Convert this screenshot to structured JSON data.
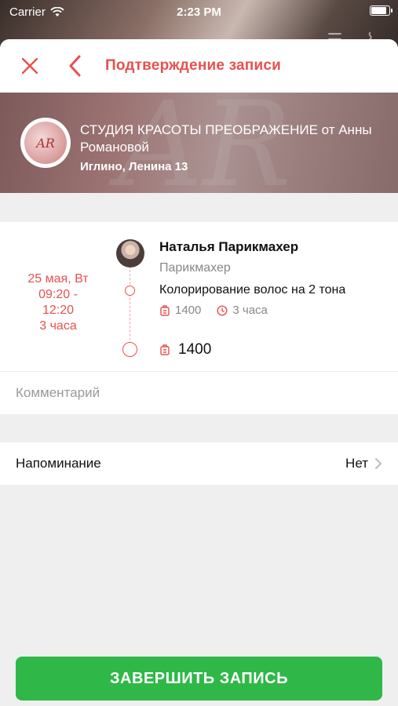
{
  "status_bar": {
    "carrier": "Carrier",
    "time": "2:23 PM"
  },
  "nav": {
    "title": "Подтверждение записи"
  },
  "salon": {
    "name": "СТУДИЯ КРАСОТЫ ПРЕОБРАЖЕНИЕ от Анны Романовой",
    "address": "Иглино, Ленина 13",
    "logo_text": "AR"
  },
  "booking": {
    "date": "25 мая, Вт",
    "time_range": "09:20 -\n12:20",
    "duration": "3 часа",
    "master_name": "Наталья Парикмахер",
    "master_role": "Парикмахер",
    "service_name": "Колорирование  волос на 2 тона",
    "service_price": "1400",
    "service_duration": "3 часа",
    "total": "1400"
  },
  "comment": {
    "placeholder": "Комментарий"
  },
  "reminder": {
    "label": "Напоминание",
    "value": "Нет"
  },
  "finish_button": {
    "label": "ЗАВЕРШИТЬ ЗАПИСЬ"
  },
  "colors": {
    "accent": "#e8504f",
    "button": "#2fb847"
  }
}
